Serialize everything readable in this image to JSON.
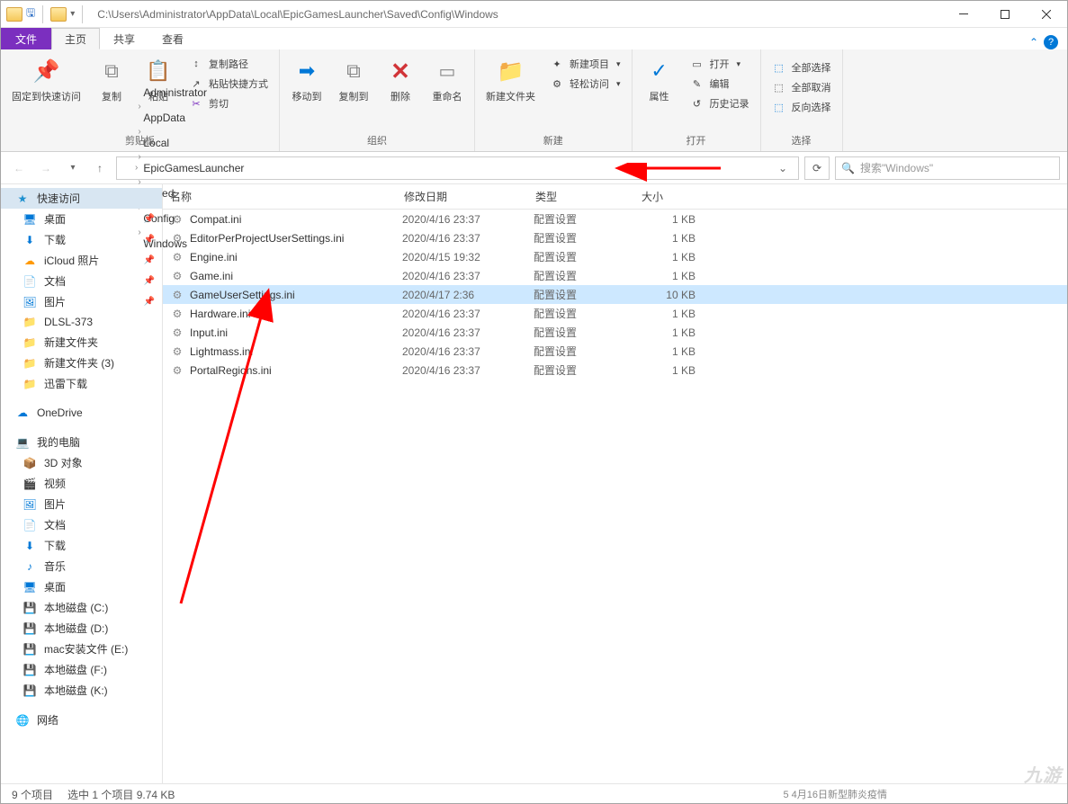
{
  "titlebar": {
    "path_text": "C:\\Users\\Administrator\\AppData\\Local\\EpicGamesLauncher\\Saved\\Config\\Windows"
  },
  "tabs": {
    "file": "文件",
    "home": "主页",
    "share": "共享",
    "view": "查看"
  },
  "ribbon": {
    "pin": "固定到快速访问",
    "copy": "复制",
    "paste": "粘贴",
    "copy_path": "复制路径",
    "paste_shortcut": "粘贴快捷方式",
    "cut": "剪切",
    "clipboard_label": "剪贴板",
    "move_to": "移动到",
    "copy_to": "复制到",
    "delete": "删除",
    "rename": "重命名",
    "organize_label": "组织",
    "new_folder": "新建文件夹",
    "new_item": "新建项目",
    "easy_access": "轻松访问",
    "new_label": "新建",
    "properties": "属性",
    "open": "打开",
    "edit": "编辑",
    "history": "历史记录",
    "open_label": "打开",
    "select_all": "全部选择",
    "select_none": "全部取消",
    "invert_selection": "反向选择",
    "select_label": "选择"
  },
  "breadcrumb": {
    "items": [
      "Administrator",
      "AppData",
      "Local",
      "EpicGamesLauncher",
      "Saved",
      "Config",
      "Windows"
    ]
  },
  "search": {
    "placeholder": "搜索\"Windows\""
  },
  "sidebar": {
    "quick_access": "快速访问",
    "desktop": "桌面",
    "downloads": "下载",
    "icloud_photos": "iCloud 照片",
    "documents": "文档",
    "pictures": "图片",
    "dlsl": "DLSL-373",
    "new_folder": "新建文件夹",
    "new_folder3": "新建文件夹 (3)",
    "xunlei": "迅雷下载",
    "onedrive": "OneDrive",
    "my_computer": "我的电脑",
    "objects_3d": "3D 对象",
    "videos": "视频",
    "pictures2": "图片",
    "documents2": "文档",
    "downloads2": "下载",
    "music": "音乐",
    "desktop2": "桌面",
    "disk_c": "本地磁盘 (C:)",
    "disk_d": "本地磁盘 (D:)",
    "mac_install": "mac安装文件 (E:)",
    "disk_f": "本地磁盘 (F:)",
    "disk_k": "本地磁盘 (K:)",
    "network": "网络"
  },
  "columns": {
    "name": "名称",
    "date": "修改日期",
    "type": "类型",
    "size": "大小"
  },
  "files": [
    {
      "name": "Compat.ini",
      "date": "2020/4/16 23:37",
      "type": "配置设置",
      "size": "1 KB",
      "selected": false
    },
    {
      "name": "EditorPerProjectUserSettings.ini",
      "date": "2020/4/16 23:37",
      "type": "配置设置",
      "size": "1 KB",
      "selected": false
    },
    {
      "name": "Engine.ini",
      "date": "2020/4/15 19:32",
      "type": "配置设置",
      "size": "1 KB",
      "selected": false
    },
    {
      "name": "Game.ini",
      "date": "2020/4/16 23:37",
      "type": "配置设置",
      "size": "1 KB",
      "selected": false
    },
    {
      "name": "GameUserSettings.ini",
      "date": "2020/4/17 2:36",
      "type": "配置设置",
      "size": "10 KB",
      "selected": true
    },
    {
      "name": "Hardware.ini",
      "date": "2020/4/16 23:37",
      "type": "配置设置",
      "size": "1 KB",
      "selected": false
    },
    {
      "name": "Input.ini",
      "date": "2020/4/16 23:37",
      "type": "配置设置",
      "size": "1 KB",
      "selected": false
    },
    {
      "name": "Lightmass.ini",
      "date": "2020/4/16 23:37",
      "type": "配置设置",
      "size": "1 KB",
      "selected": false
    },
    {
      "name": "PortalRegions.ini",
      "date": "2020/4/16 23:37",
      "type": "配置设置",
      "size": "1 KB",
      "selected": false
    }
  ],
  "statusbar": {
    "items_count": "9 个项目",
    "selected_info": "选中 1 个项目   9.74 KB"
  },
  "watermark": "九游",
  "bottom_cut": "5   4月16日新型肺炎疫情"
}
